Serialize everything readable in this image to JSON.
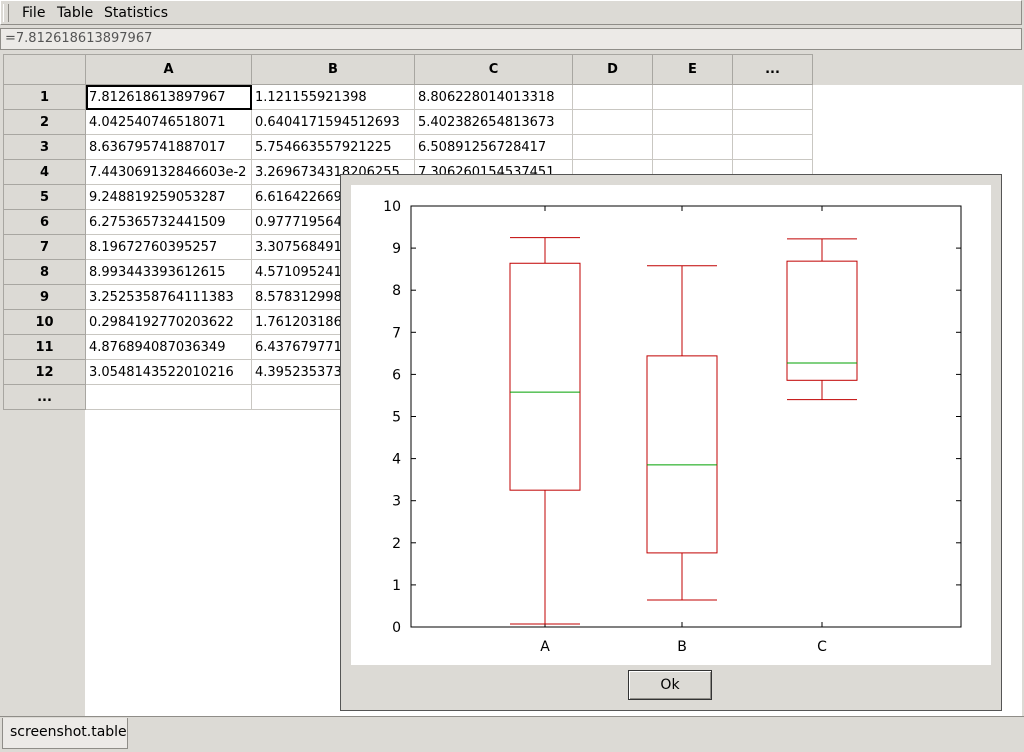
{
  "menu": {
    "file": "File",
    "table": "Table",
    "statistics": "Statistics"
  },
  "formula_bar": {
    "value": "=7.812618613897967"
  },
  "sheet": {
    "columns": [
      "A",
      "B",
      "C",
      "D",
      "E",
      "..."
    ],
    "row_labels": [
      "1",
      "2",
      "3",
      "4",
      "5",
      "6",
      "7",
      "8",
      "9",
      "10",
      "11",
      "12",
      "..."
    ],
    "cells": [
      [
        "7.812618613897967",
        "1.121155921398",
        "8.806228014013318"
      ],
      [
        "4.042540746518071",
        "0.6404171594512693",
        "5.402382654813673"
      ],
      [
        "8.636795741887017",
        "5.754663557921225",
        "6.50891256728417"
      ],
      [
        "7.443069132846603e-2",
        "3.2696734318206255",
        "7.306260154537451"
      ],
      [
        "9.248819259053287",
        "6.616422669",
        ""
      ],
      [
        "6.275365732441509",
        "0.977719564",
        ""
      ],
      [
        "8.19672760395257",
        "3.307568491",
        ""
      ],
      [
        "8.993443393612615",
        "4.571095241",
        ""
      ],
      [
        "3.2525358764111383",
        "8.578312998",
        ""
      ],
      [
        "0.2984192770203622",
        "1.761203186",
        ""
      ],
      [
        "4.876894087036349",
        "6.437679771",
        ""
      ],
      [
        "3.0548143522010216",
        "4.395235373",
        ""
      ],
      [
        "",
        "",
        ""
      ]
    ]
  },
  "dialog": {
    "ok_label": "Ok"
  },
  "tabs": [
    {
      "label": "screenshot.table"
    }
  ],
  "colors": {
    "box": "#c00000",
    "median": "#00a000"
  },
  "chart_data": {
    "type": "boxplot",
    "categories": [
      "A",
      "B",
      "C"
    ],
    "ylim": [
      0,
      10
    ],
    "yticks": [
      "0",
      "1",
      "2",
      "3",
      "4",
      "5",
      "6",
      "7",
      "8",
      "9",
      "10"
    ],
    "boxes": [
      {
        "label": "A",
        "min": 0.07,
        "q1": 3.25,
        "median": 5.58,
        "q3": 8.64,
        "max": 9.25
      },
      {
        "label": "B",
        "min": 0.64,
        "q1": 1.76,
        "median": 3.85,
        "q3": 6.44,
        "max": 8.58
      },
      {
        "label": "C",
        "min": 5.4,
        "q1": 5.86,
        "median": 6.27,
        "q3": 8.69,
        "max": 9.22
      }
    ]
  }
}
